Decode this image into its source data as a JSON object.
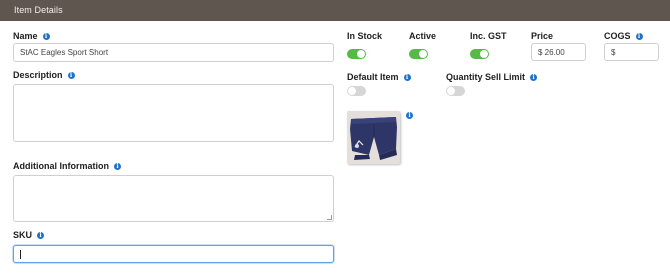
{
  "header": {
    "title": "Item Details"
  },
  "name": {
    "label": "Name",
    "value": "StAC Eagles Sport Short"
  },
  "description": {
    "label": "Description",
    "value": ""
  },
  "additional_information": {
    "label": "Additional Information",
    "value": ""
  },
  "sku": {
    "label": "SKU",
    "value": ""
  },
  "in_stock": {
    "label": "In Stock",
    "on": true
  },
  "active": {
    "label": "Active",
    "on": true
  },
  "inc_gst": {
    "label": "Inc. GST",
    "on": true
  },
  "price": {
    "label": "Price",
    "value": "$ 26.00"
  },
  "cogs": {
    "label": "COGS",
    "value": "$"
  },
  "default_item": {
    "label": "Default Item",
    "on": false
  },
  "quantity_sell_limit": {
    "label": "Quantity Sell Limit",
    "on": false
  },
  "colors": {
    "header_bg": "#5f5650",
    "toggle_on": "#57b947",
    "toggle_off": "#d6d6d6",
    "info": "#1d73c9",
    "focus": "#5ea3e6"
  },
  "icons": {
    "info": "info-icon"
  }
}
